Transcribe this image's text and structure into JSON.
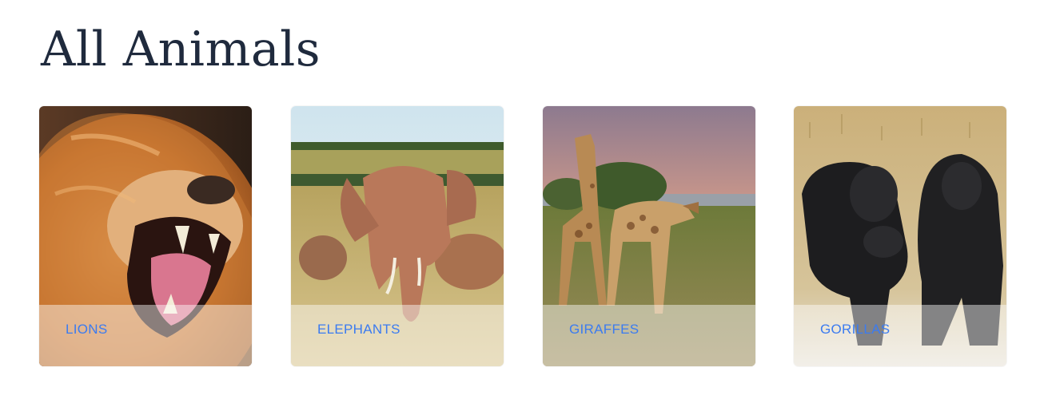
{
  "page": {
    "title": "All Animals"
  },
  "cards": [
    {
      "label": "LIONS"
    },
    {
      "label": "ELEPHANTS"
    },
    {
      "label": "GIRAFFES"
    },
    {
      "label": "GORILLAS"
    }
  ],
  "colors": {
    "title_text": "#1f2a3d",
    "link_text": "#3b7bf0",
    "caption_overlay": "rgba(255,255,255,0.45)"
  }
}
